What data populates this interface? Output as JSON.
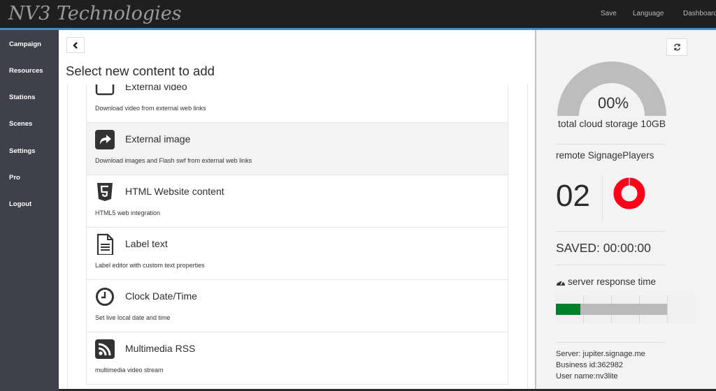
{
  "app": {
    "brand": "NV3 Technologies",
    "accent_color": "#3a8fd0"
  },
  "topnav": {
    "save": "Save",
    "language": "Language",
    "dashboard": "Dashboard"
  },
  "sidebar": {
    "items": [
      {
        "label": "Campaign"
      },
      {
        "label": "Resources"
      },
      {
        "label": "Stations"
      },
      {
        "label": "Scenes"
      },
      {
        "label": "Settings"
      },
      {
        "label": "Pro"
      },
      {
        "label": "Logout"
      }
    ]
  },
  "main": {
    "back_icon": "chevron-left-icon",
    "title": "Select new content to add",
    "items": [
      {
        "title": "External video",
        "description": "Download video from external web links",
        "icon": "video-icon",
        "active": false
      },
      {
        "title": "External image",
        "description": "Download images and Flash swf from external web links",
        "icon": "share-arrow-icon",
        "active": true
      },
      {
        "title": "HTML Website content",
        "description": "HTML5 web integration",
        "icon": "html5-icon",
        "active": false
      },
      {
        "title": "Label text",
        "description": "Label editor with custom text properties",
        "icon": "document-text-icon",
        "active": false
      },
      {
        "title": "Clock Date/Time",
        "description": "Set live local date and time",
        "icon": "clock-icon",
        "active": false
      },
      {
        "title": "Multimedia RSS",
        "description": "multimedia video stream",
        "icon": "rss-icon",
        "active": false
      }
    ]
  },
  "right_panel": {
    "refresh_icon": "refresh-icon",
    "storage": {
      "percent_text": "00%",
      "percent_used": 0,
      "label": "total cloud storage 10GB",
      "color": "#bdbdbd"
    },
    "players": {
      "label": "remote SignagePlayers",
      "count": "02",
      "donut_color": "#ff0018"
    },
    "saved": "SAVED: 00:00:00",
    "server_response": {
      "label": "server response time",
      "icon": "dashboard-gauge-icon",
      "fill_fraction": 0.22,
      "fill_color": "#00802b",
      "track_color": "#bababa"
    },
    "info": {
      "server": "Server: jupiter.signage.me",
      "business_id": "Business id:362982",
      "user_name": "User name:nv3lite"
    }
  }
}
